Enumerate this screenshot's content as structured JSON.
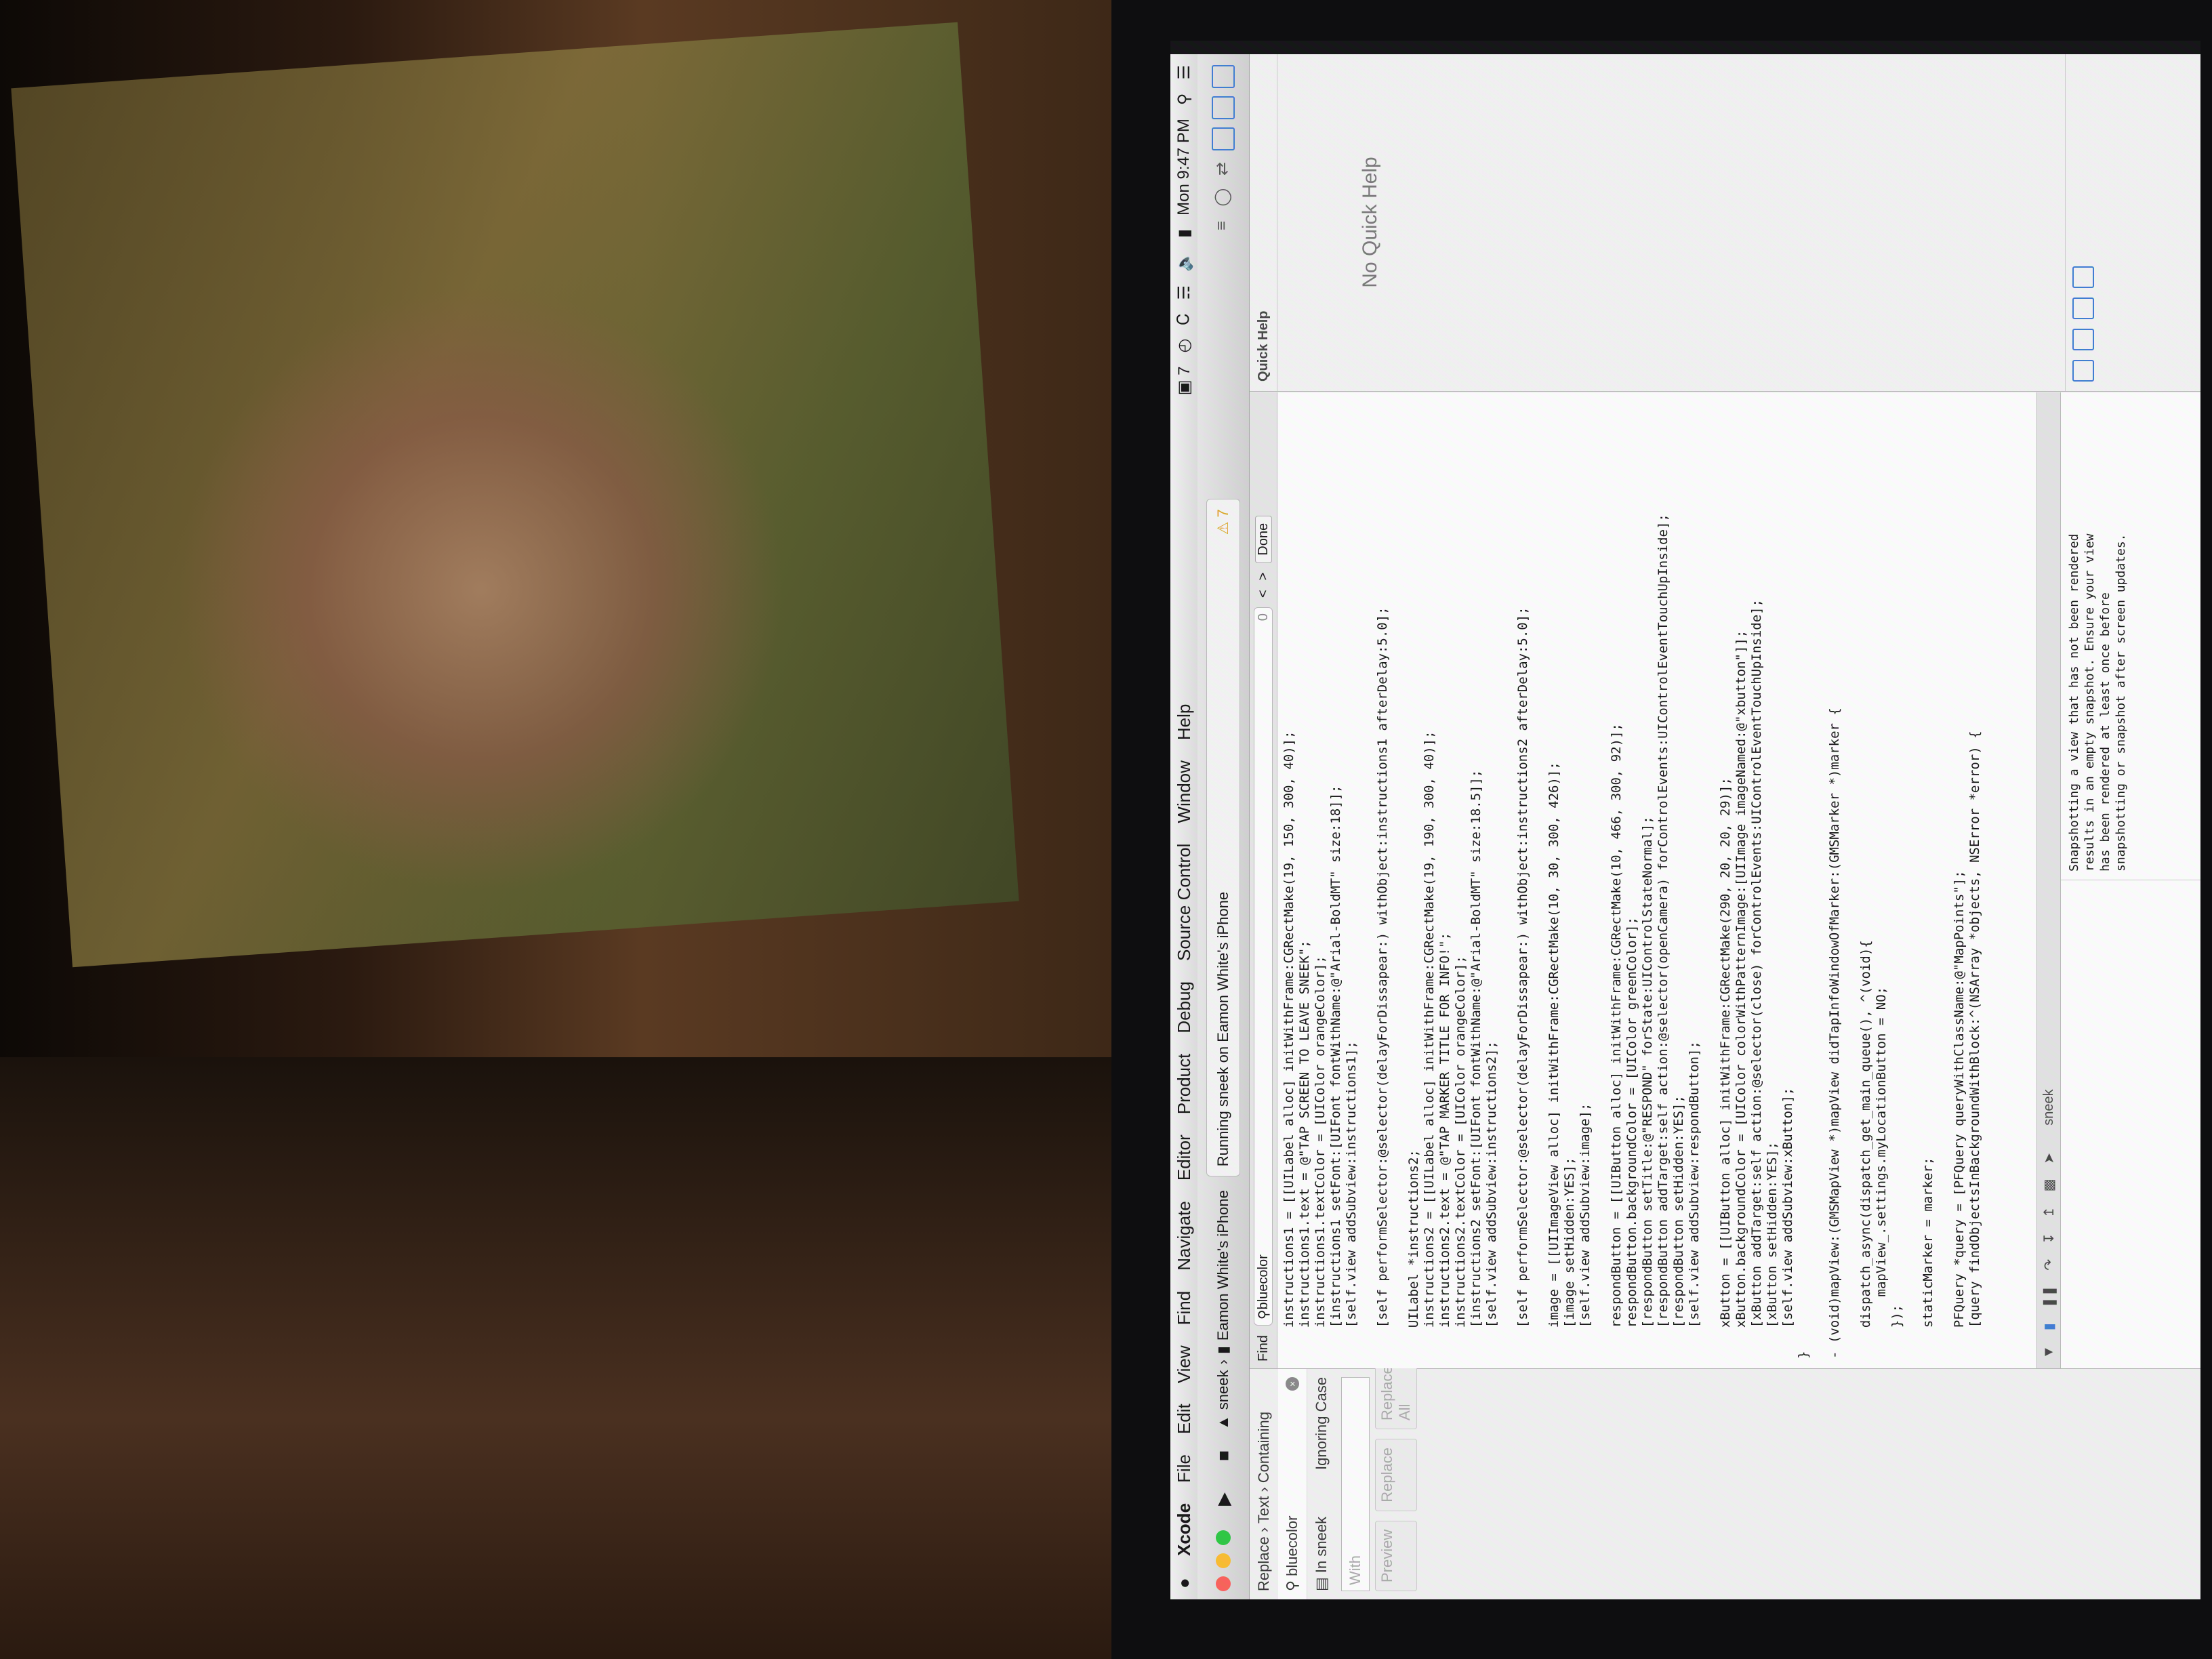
{
  "menubar": {
    "app": "Xcode",
    "items": [
      "File",
      "Edit",
      "View",
      "Find",
      "Navigate",
      "Editor",
      "Product",
      "Debug",
      "Source Control",
      "Window",
      "Help"
    ],
    "status": {
      "clock": "Mon 9:47 PM",
      "badge": "7"
    }
  },
  "toolbar": {
    "scheme": "sneek",
    "device": "Eamon White's iPhone",
    "activity": "Running sneek on Eamon White's iPhone",
    "warnings": "7"
  },
  "navigator": {
    "mode": [
      "Replace",
      "Text",
      "Containing"
    ],
    "search": "bluecolor",
    "scope": "In sneek",
    "match": "Ignoring Case",
    "with_placeholder": "With",
    "buttons": [
      "Preview",
      "Replace",
      "Replace All"
    ]
  },
  "findbar": {
    "label": "Find",
    "query": "bluecolor",
    "count": "0",
    "done": "Done"
  },
  "editor": {
    "lines": [
      "    instructions1 = [[UILabel alloc] initWithFrame:CGRectMake(19, 150, 300, 40)];",
      "    instructions1.text = @\"TAP SCREEN TO LEAVE SNEEK\";",
      "    instructions1.textColor = [UIColor orangeColor];",
      "    [instructions1 setFont:[UIFont fontWithName:@\"Arial-BoldMT\" size:18]];",
      "    [self.view addSubview:instructions1];",
      "",
      "    [self performSelector:@selector(delayForDissapear:) withObject:instructions1 afterDelay:5.0];",
      "",
      "    UILabel *instructions2;",
      "    instructions2 = [[UILabel alloc] initWithFrame:CGRectMake(19, 190, 300, 40)];",
      "    instructions2.text = @\"TAP MARKER TITLE FOR INFO!\";",
      "    instructions2.textColor = [UIColor orangeColor];",
      "    [instructions2 setFont:[UIFont fontWithName:@\"Arial-BoldMT\" size:18.5]];",
      "    [self.view addSubview:instructions2];",
      "",
      "    [self performSelector:@selector(delayForDissapear:) withObject:instructions2 afterDelay:5.0];",
      "",
      "    image = [[UIImageView alloc] initWithFrame:CGRectMake(10, 30, 300, 426)];",
      "    [image setHidden:YES];",
      "    [self.view addSubview:image];",
      "",
      "    respondButton = [[UIButton alloc] initWithFrame:CGRectMake(10, 466, 300, 92)];",
      "    respondButton.backgroundColor = [UIColor greenColor];",
      "    [respondButton setTitle:@\"RESPOND\" forState:UIControlStateNormal];",
      "    [respondButton addTarget:self action:@selector(openCamera) forControlEvents:UIControlEventTouchUpInside];",
      "    [respondButton setHidden:YES];",
      "    [self.view addSubview:respondButton];",
      "",
      "    xButton = [[UIButton alloc] initWithFrame:CGRectMake(290, 20, 20, 29)];",
      "    xButton.backgroundColor = [UIColor colorWithPatternImage:[UIImage imageNamed:@\"xbutton\"]];",
      "    [xButton addTarget:self action:@selector(close) forControlEvents:UIControlEventTouchUpInside];",
      "    [xButton setHidden:YES];",
      "    [self.view addSubview:xButton];",
      "}",
      "",
      "- (void)mapView:(GMSMapView *)mapView didTapInfoWindowOfMarker:(GMSMarker *)marker {",
      "",
      "    dispatch_async(dispatch_get_main_queue(), ^(void){",
      "        mapView_.settings.myLocationButton = NO;",
      "    });",
      "",
      "    staticMarker = marker;",
      "",
      "    PFQuery *query = [PFQuery queryWithClassName:@\"MapPoints\"];",
      "    [query findObjectsInBackgroundWithBlock:^(NSArray *objects, NSError *error) {"
    ]
  },
  "debugbar": {
    "target": "sneek"
  },
  "console": {
    "lines": [
      "Snapshotting a view that has not been rendered",
      "results in an empty snapshot. Ensure your view",
      "has been rendered at least once before",
      "snapshotting or snapshot after screen updates."
    ]
  },
  "utility": {
    "header": "Quick Help",
    "empty": "No Quick Help"
  },
  "colors": {
    "accent": "#3b7bd4",
    "warning": "#e0a020",
    "close": "#fc5f57",
    "minimize": "#fdbc2e",
    "zoom": "#29c840"
  }
}
